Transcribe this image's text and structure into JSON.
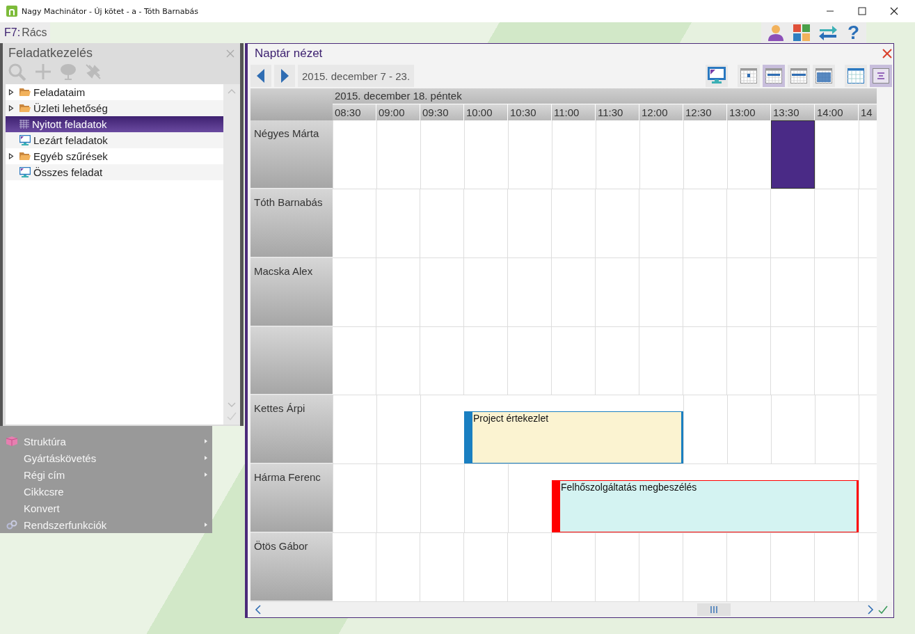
{
  "window": {
    "title": "Nagy Machinátor - Új kötet - a - Tóth Barnabás"
  },
  "toolbar": {
    "shortcut_key": "F7:",
    "shortcut_label": "Rács",
    "help_label": "?"
  },
  "task_panel": {
    "title": "Feladatkezelés",
    "items": [
      {
        "label": "Feladataim",
        "kind": "folder",
        "expanded": false,
        "selected": false
      },
      {
        "label": "Üzleti lehetőség",
        "kind": "folder",
        "expanded": false,
        "selected": false
      },
      {
        "label": "Nyitott feladatok",
        "kind": "grid",
        "selected": true
      },
      {
        "label": "Lezárt feladatok",
        "kind": "monitor",
        "selected": false
      },
      {
        "label": "Egyéb szűrések",
        "kind": "folder",
        "expanded": false,
        "selected": false
      },
      {
        "label": "Összes feladat",
        "kind": "monitor",
        "selected": false
      }
    ]
  },
  "menu": {
    "items": [
      {
        "label": "Struktúra",
        "kind": "cube",
        "submenu": true
      },
      {
        "label": "Gyártáskövetés",
        "kind": "none",
        "submenu": true
      },
      {
        "label": "Régi cím",
        "kind": "none",
        "submenu": true
      },
      {
        "label": "Cikkcsre",
        "kind": "none",
        "submenu": false
      },
      {
        "label": "Konvert",
        "kind": "none",
        "submenu": false
      },
      {
        "label": "Rendszerfunkciók",
        "kind": "link",
        "submenu": true
      }
    ]
  },
  "calendar": {
    "title": "Naptár nézet",
    "range": "2015. december 7 - 23.",
    "view_buttons": [
      {
        "kind": "day",
        "selected": false
      },
      {
        "kind": "week",
        "selected": true
      },
      {
        "kind": "workweek",
        "selected": false
      },
      {
        "kind": "month",
        "selected": false
      }
    ],
    "layout_buttons": [
      {
        "kind": "grid",
        "selected": false
      },
      {
        "kind": "timeline",
        "selected": true
      }
    ],
    "day": "2015. december 18. péntek",
    "slots": [
      "08:30",
      "09:00",
      "09:30",
      "10:00",
      "10:30",
      "11:00",
      "11:30",
      "12:00",
      "12:30",
      "13:00",
      "13:30",
      "14:00",
      "14"
    ],
    "rows": [
      {
        "name": "Négyes Márta",
        "booked": [
          false,
          false,
          false,
          false,
          false,
          false,
          false,
          false,
          false,
          false,
          true,
          false,
          false
        ],
        "event": {
          "kind": "block",
          "color": "#4a2a86"
        }
      },
      {
        "name": "Tóth Barnabás"
      },
      {
        "name": "Macska Alex"
      },
      {},
      {
        "name": "Kettes Árpi",
        "booked": [
          false,
          false,
          false,
          true,
          true,
          true,
          true,
          true,
          false,
          false,
          false,
          false,
          false
        ],
        "event": {
          "kind": "labeled",
          "title": "Project értekezlet",
          "color": "#fbf3d1",
          "marker": {
            "color": "#1a7fc1"
          }
        }
      },
      {
        "name": "Hárma Ferenc",
        "booked": [
          false,
          false,
          false,
          false,
          false,
          true,
          true,
          true,
          true,
          true,
          true,
          true,
          false
        ],
        "event": {
          "kind": "labeled",
          "title": "Felhőszolgáltatás megbeszélés",
          "color": "#d4f3f2",
          "marker": {
            "color": "#ff0000"
          }
        }
      },
      {
        "name": "Ötös Gábor"
      }
    ]
  }
}
